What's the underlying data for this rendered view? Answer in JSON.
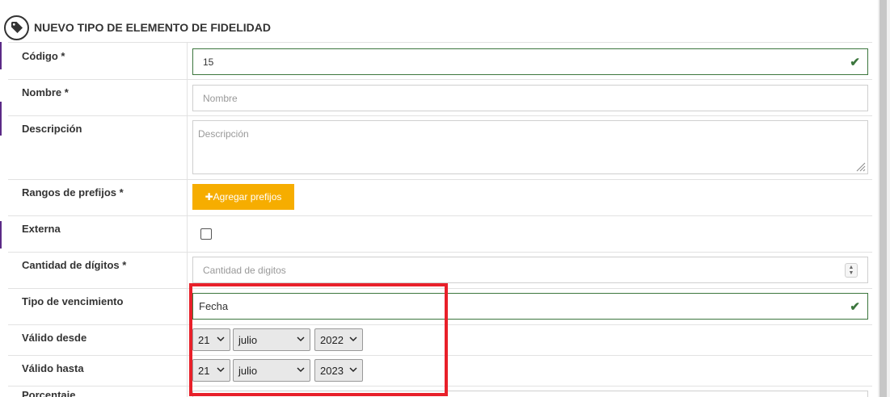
{
  "header": {
    "title": "NUEVO TIPO DE ELEMENTO DE FIDELIDAD",
    "icon": "tag-icon"
  },
  "form": {
    "codigo": {
      "label": "Código *",
      "value": "15"
    },
    "nombre": {
      "label": "Nombre *",
      "placeholder": "Nombre"
    },
    "descripcion": {
      "label": "Descripción",
      "placeholder": "Descripción"
    },
    "rangos": {
      "label": "Rangos de prefijos *",
      "button": "✚Agregar prefijos"
    },
    "externa": {
      "label": "Externa",
      "checked": false
    },
    "cantidad": {
      "label": "Cantidad de dígitos *",
      "placeholder": "Cantidad de digitos"
    },
    "tipo_venc": {
      "label": "Tipo de vencimiento",
      "value": "Fecha"
    },
    "valido_desde": {
      "label": "Válido desde",
      "day": "21",
      "month": "julio",
      "year": "2022"
    },
    "valido_hasta": {
      "label": "Válido hasta",
      "day": "21",
      "month": "julio",
      "year": "2023"
    },
    "next_partial": {
      "label": "Porcentaje"
    }
  },
  "colors": {
    "accent": "#f6ad00",
    "valid": "#3c763d",
    "highlight": "#e8202a",
    "sidebar_accent": "#5b2a86"
  }
}
